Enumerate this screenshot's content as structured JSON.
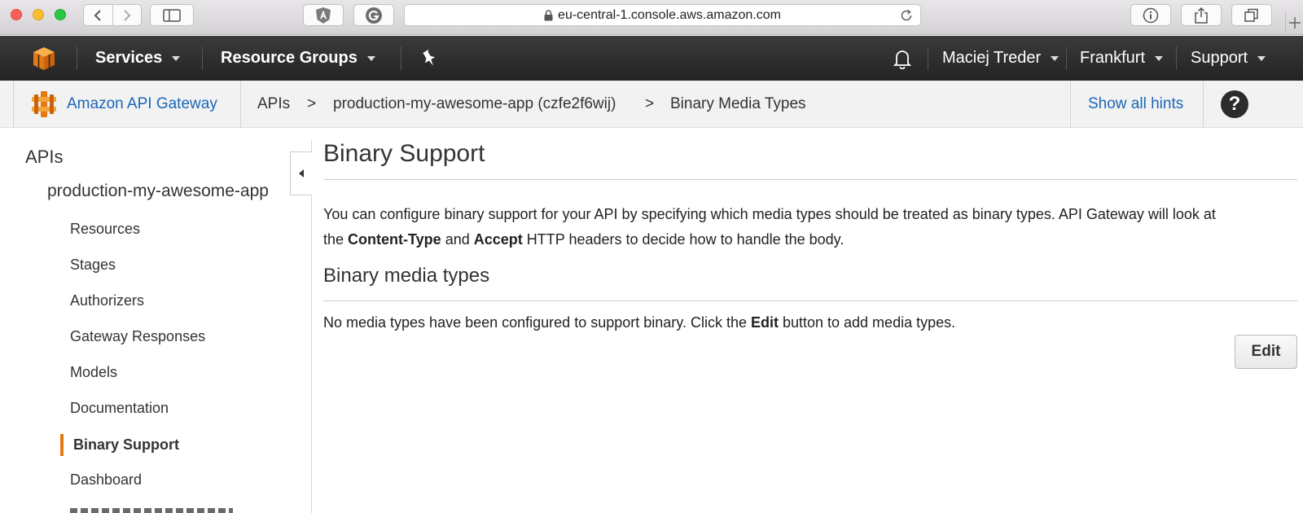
{
  "browser": {
    "url": "eu-central-1.console.aws.amazon.com"
  },
  "aws_nav": {
    "services": "Services",
    "resource_groups": "Resource Groups",
    "user": "Maciej Treder",
    "region": "Frankfurt",
    "support": "Support"
  },
  "breadcrumb": {
    "service": "Amazon API Gateway",
    "apis": "APIs",
    "sep1": ">",
    "api_name": "production-my-awesome-app (czfe2f6wij)",
    "sep2": ">",
    "current": "Binary Media Types",
    "hints": "Show all hints",
    "help": "?"
  },
  "sidebar": {
    "title": "APIs",
    "api": "production-my-awesome-app",
    "items": [
      {
        "label": "Resources"
      },
      {
        "label": "Stages"
      },
      {
        "label": "Authorizers"
      },
      {
        "label": "Gateway Responses"
      },
      {
        "label": "Models"
      },
      {
        "label": "Documentation"
      },
      {
        "label": "Binary Support",
        "active": true
      },
      {
        "label": "Dashboard"
      }
    ]
  },
  "main": {
    "title": "Binary Support",
    "desc_1": "You can configure binary support for your API by specifying which media types should be treated as binary types. API Gateway will look at",
    "desc_2_a": "the ",
    "desc_2_b": "Content-Type",
    "desc_2_c": " and ",
    "desc_2_d": "Accept",
    "desc_2_e": " HTTP headers to decide how to handle the body.",
    "section_title": "Binary media types",
    "empty_a": "No media types have been configured to support binary. Click the ",
    "empty_b": "Edit",
    "empty_c": " button to add media types.",
    "edit_label": "Edit"
  },
  "colors": {
    "aws_orange": "#e47911",
    "link_blue": "#1a66b9",
    "nav_dark": "#232323"
  }
}
